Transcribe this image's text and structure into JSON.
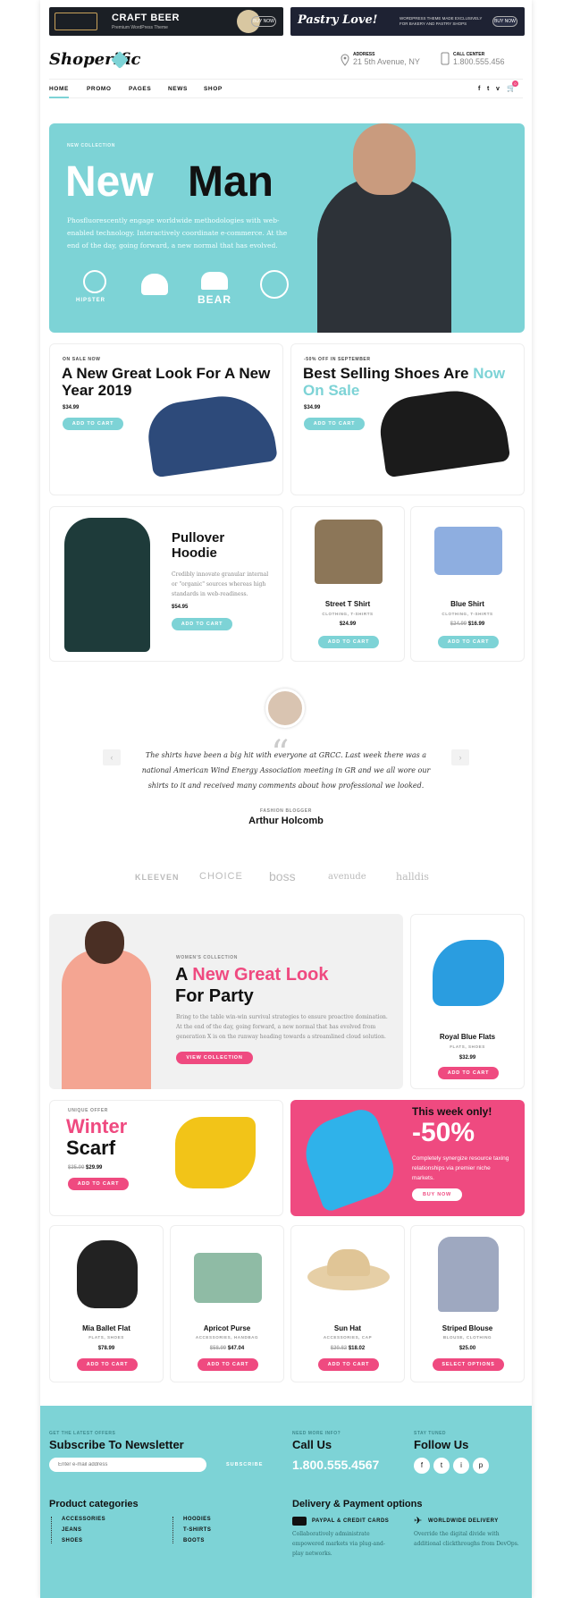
{
  "banners": {
    "b1": {
      "title": "CRAFT BEER",
      "subtitle": "Premium WordPress Theme",
      "button": "BUY NOW"
    },
    "b2": {
      "title": "Pastry Love!",
      "subtitle": "WORDPRESS THEME MADE EXCLUSIVELY FOR BAKERY AND PASTRY SHOPS",
      "button": "BUY NOW"
    }
  },
  "brand": {
    "logo": "Shoperific",
    "accent": "#7dd3d6",
    "pink": "#ef4a80"
  },
  "header": {
    "address_label": "ADDRESS",
    "address": "21 5th Avenue, NY",
    "call_label": "CALL CENTER",
    "phone": "1.800.555.456",
    "cart_count": "0"
  },
  "nav": [
    "HOME",
    "PROMO",
    "PAGES",
    "NEWS",
    "SHOP"
  ],
  "social": [
    "f",
    "t",
    "v"
  ],
  "hero": {
    "kicker": "NEW COLLECTION",
    "title_a": "New",
    "title_b": "Man",
    "text": "Phosfluorescently engage worldwide methodologies with web-enabled technology. Interactively coordinate e-commerce. At the end of the day, going forward, a new normal that has evolved.",
    "icons": [
      "HIPSTER",
      "",
      "BEAR",
      ""
    ]
  },
  "promo1": {
    "kicker": "ON SALE NOW",
    "title": "A New Great Look For A New Year 2019",
    "price": "$34.99",
    "button": "ADD TO CART"
  },
  "promo2": {
    "kicker": "-50% OFF IN SEPTEMBER",
    "title_a": "Best Selling Shoes Are",
    "title_b": "Now On Sale",
    "price": "$34.99",
    "button": "ADD TO CART"
  },
  "hoodie": {
    "title": "Pullover Hoodie",
    "text": "Credibly innovate granular internal or \"organic\" sources whereas high standards in web-readiness.",
    "price": "$54.95",
    "button": "ADD TO CART"
  },
  "row1": [
    {
      "name": "Street T Shirt",
      "cat": "CLOTHING, T-SHIRTS",
      "price": "$24.99",
      "button": "ADD TO CART"
    },
    {
      "name": "Blue Shirt",
      "cat": "CLOTHING, T-SHIRTS",
      "old": "$24.99",
      "price": "$16.99",
      "button": "ADD TO CART"
    }
  ],
  "testimonial": {
    "quote": "The shirts have been a big hit with everyone at GRCC. Last week there was a national American Wind Energy Association meeting in GR and we all wore our shirts to it and received many comments about how professional we looked.",
    "role": "FASHION BLOGGER",
    "name": "Arthur Holcomb"
  },
  "brands": [
    "KLEEVEN",
    "CHOICE",
    "boss",
    "avenude",
    "halldis"
  ],
  "women": {
    "kicker": "WOMEN'S COLLECTION",
    "title_a": "A",
    "title_b": "New Great Look",
    "title_c": "For Party",
    "text": "Bring to the table win-win survival strategies to ensure proactive domination. At the end of the day, going forward, a new normal that has evolved from generation X is on the runway heading towards a streamlined cloud solution.",
    "button": "VIEW COLLECTION"
  },
  "flats": {
    "name": "Royal Blue Flats",
    "cat": "FLATS, SHOES",
    "price": "$32.99",
    "button": "ADD TO CART"
  },
  "scarf": {
    "kicker": "UNIQUE OFFER",
    "title_a": "Winter",
    "title_b": "Scarf",
    "old": "$35.00",
    "price": "$29.99",
    "button": "ADD TO CART"
  },
  "week": {
    "title": "This week only!",
    "discount": "-50%",
    "text": "Completely synergize resource taxing relationships via premier niche markets.",
    "button": "BUY NOW"
  },
  "row2": [
    {
      "name": "Mia Ballet Flat",
      "cat": "FLATS, SHOES",
      "price": "$78.99",
      "button": "ADD TO CART"
    },
    {
      "name": "Apricot Purse",
      "cat": "ACCESSORIES, HANDBAG",
      "old": "$58.99",
      "price": "$47.04",
      "button": "ADD TO CART"
    },
    {
      "name": "Sun Hat",
      "cat": "ACCESSORIES, CAP",
      "old": "$20.82",
      "price": "$18.02",
      "button": "ADD TO CART"
    },
    {
      "name": "Striped Blouse",
      "cat": "BLOUSE, CLOTHING",
      "price": "$25.00",
      "button": "SELECT OPTIONS"
    }
  ],
  "footer": {
    "news_label": "GET THE LATEST OFFERS",
    "news_title": "Subscribe To Newsletter",
    "email_placeholder": "Enter e-mail address",
    "subscribe": "SUBSCRIBE",
    "call_label": "NEED MORE INFO?",
    "call_title": "Call Us",
    "phone": "1.800.555.4567",
    "follow_label": "STAY TUNED",
    "follow_title": "Follow Us",
    "social": [
      "f",
      "t",
      "i",
      "p"
    ],
    "cat_title": "Product categories",
    "cats": [
      "ACCESSORIES",
      "HOODIES",
      "JEANS",
      "T-SHIRTS",
      "SHOES",
      "BOOTS"
    ],
    "del_title": "Delivery & Payment options",
    "pay_title": "PAYPAL & CREDIT CARDS",
    "pay_text": "Collaboratively administrate empowered markets via plug-and-play networks.",
    "ship_title": "WORLDWIDE DELIVERY",
    "ship_text": "Override the digital divide with additional clickthroughs from DevOps."
  }
}
